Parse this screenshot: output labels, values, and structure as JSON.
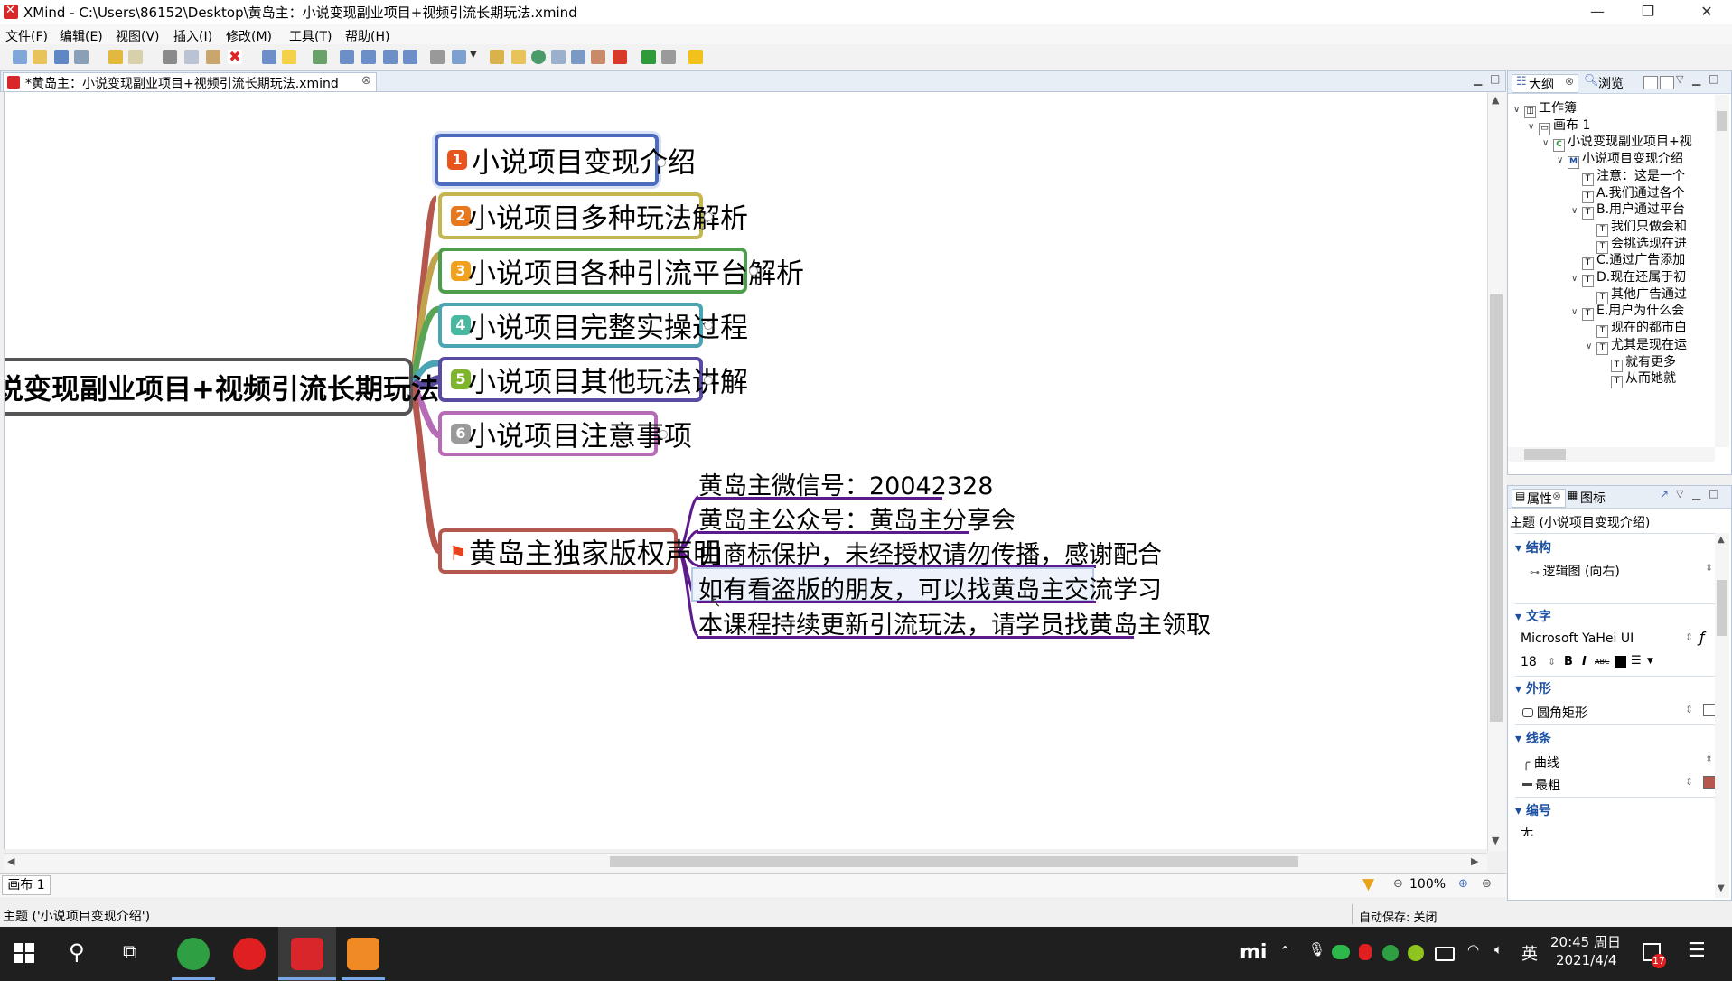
{
  "window": {
    "title": "XMind - C:\\Users\\86152\\Desktop\\黄岛主：小说变现副业项目+视频引流长期玩法.xmind",
    "minimize": "—",
    "restore": "❐",
    "close": "✕"
  },
  "menubar": {
    "file": "文件(F)",
    "edit": "编辑(E)",
    "view": "视图(V)",
    "insert": "插入(I)",
    "modify": "修改(M)",
    "tools": "工具(T)",
    "help": "帮助(H)"
  },
  "editor": {
    "tab_label": "*黄岛主：小说变现副业项目+视频引流长期玩法.xmind",
    "tab_close": "⊗"
  },
  "mindmap": {
    "central": "说变现副业项目+视频引流长期玩法",
    "topics": [
      {
        "num": "1",
        "label": "小说项目变现介绍",
        "border": "#4c6bbf",
        "line": "#b5574d",
        "badge": "#e8541e"
      },
      {
        "num": "2",
        "label": "小说项目多种玩法解析",
        "border": "#c5b64f",
        "line": "#c0a34c",
        "badge": "#e8781e"
      },
      {
        "num": "3",
        "label": "小说项目各种引流平台解析",
        "border": "#4d9e4a",
        "line": "#5aa555",
        "badge": "#f0a21a"
      },
      {
        "num": "4",
        "label": "小说项目完整实操过程",
        "border": "#4aa4b4",
        "line": "#4aa4b4",
        "badge": "#48b8a0"
      },
      {
        "num": "5",
        "label": "小说项目其他玩法讲解",
        "border": "#5a4aa0",
        "line": "#5a4aa0",
        "badge": "#7fb52e"
      },
      {
        "num": "6",
        "label": "小说项目注意事项",
        "border": "#b56bb5",
        "line": "#b56bb5",
        "badge": "#9a9a9a"
      }
    ],
    "copyright": {
      "label": "黄岛主独家版权声明",
      "border": "#b5574d",
      "flag_color": "#e8411e",
      "items": [
        "黄岛主微信号：20042328",
        "黄岛主公众号：黄岛主分享会",
        "由商标保护，未经授权请勿传播，感谢配合",
        "如有看盗版的朋友，可以找黄岛主交流学习",
        "本课程持续更新引流玩法，请学员找黄岛主领取"
      ]
    }
  },
  "sheetbar": {
    "sheet_tab": "画布 1",
    "zoom": "100%"
  },
  "outline": {
    "tab_outline": "大纲",
    "tab_browse": "浏览",
    "items": [
      {
        "level": 0,
        "label": "工作簿"
      },
      {
        "level": 1,
        "label": "画布 1"
      },
      {
        "level": 2,
        "label": "小说变现副业项目+视"
      },
      {
        "level": 3,
        "label": "小说项目变现介绍"
      },
      {
        "level": 4,
        "label": "注意：这是一个"
      },
      {
        "level": 4,
        "label": "A.我们通过各个"
      },
      {
        "level": 4,
        "label": "B.用户通过平台"
      },
      {
        "level": 5,
        "label": "我们只做会和"
      },
      {
        "level": 5,
        "label": "会挑选现在进"
      },
      {
        "level": 4,
        "label": "C.通过广告添加"
      },
      {
        "level": 4,
        "label": "D.现在还属于初"
      },
      {
        "level": 5,
        "label": "其他广告通过"
      },
      {
        "level": 4,
        "label": "E.用户为什么会"
      },
      {
        "level": 5,
        "label": "现在的都市白"
      },
      {
        "level": 5,
        "label": "尤其是现在运"
      },
      {
        "level": 6,
        "label": "就有更多"
      },
      {
        "level": 6,
        "label": "从而她就"
      }
    ]
  },
  "properties": {
    "tab_props": "属性",
    "tab_icons": "图标",
    "subject": "主题 (小说项目变现介绍)",
    "sec_structure": "结构",
    "structure_value": "逻辑图 (向右)",
    "sec_text": "文字",
    "font_name": "Microsoft YaHei UI",
    "font_size": "18",
    "bold": "B",
    "italic": "I",
    "strike": "ABC",
    "sec_shape": "外形",
    "shape_value": "圆角矩形",
    "sec_line": "线条",
    "line_shape": "曲线",
    "line_width": "最粗",
    "line_color": "#b5574d",
    "sec_numbering": "编号",
    "numbering_value": "无"
  },
  "statusbar": {
    "left": "主题 ('小说项目变现介绍')",
    "autosave": "自动保存: 关闭"
  },
  "taskbar": {
    "ime": "英",
    "time": "20:45 周日",
    "date": "2021/4/4",
    "notif_count": "17",
    "mi_logo": "mi"
  }
}
